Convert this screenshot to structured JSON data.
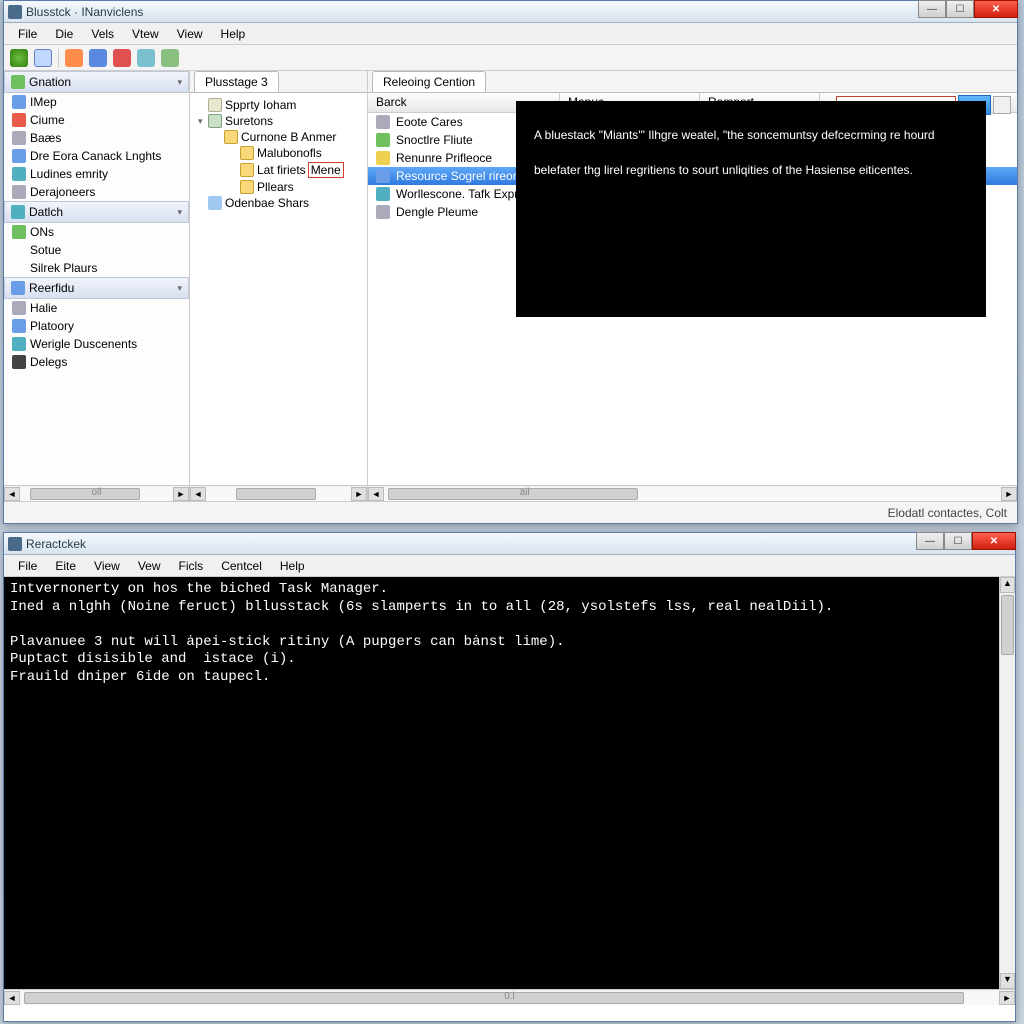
{
  "win1": {
    "title": "Blusstck · INanviclens",
    "menu": [
      "File",
      "Die",
      "Vels",
      "Vtew",
      "View",
      "Help"
    ],
    "status": "Elodatl contactes, Colt",
    "left": {
      "groups": [
        {
          "header": "Gnation",
          "icon": "ci-grn",
          "items": [
            {
              "label": "IMep",
              "icon": "ci-blue"
            },
            {
              "label": "Ciume",
              "icon": "ci-red"
            },
            {
              "label": "Baæs",
              "icon": "ci-gry"
            },
            {
              "label": "Dre Eora Canack Lnghts",
              "icon": "ci-blue"
            },
            {
              "label": "Ludines emrity",
              "icon": "ci-teal"
            },
            {
              "label": "Derajoneers",
              "icon": "ci-gry"
            }
          ]
        },
        {
          "header": "Datlch",
          "icon": "ci-teal",
          "items": [
            {
              "label": "ONs",
              "icon": "ci-grn"
            },
            {
              "label": "Sotue",
              "icon": ""
            },
            {
              "label": "Silrek Plaurs",
              "icon": ""
            }
          ]
        },
        {
          "header": "Reerfidu",
          "icon": "ci-blue",
          "items": [
            {
              "label": "Halie",
              "icon": "ci-gry"
            },
            {
              "label": "Platoory",
              "icon": "ci-blue"
            },
            {
              "label": "Werigle Duscenents",
              "icon": "ci-teal"
            },
            {
              "label": "Delegs",
              "icon": "ci-dk"
            }
          ]
        }
      ],
      "scroll_label": "oll"
    },
    "mid": {
      "tab": "Plusstage 3",
      "tree": [
        {
          "label": "Spprty Ioham",
          "icon": "ti-doc",
          "depth": 0
        },
        {
          "label": "Suretons",
          "icon": "ti-grp",
          "depth": 0,
          "exp": true
        },
        {
          "label": "Curnone B Anmer",
          "icon": "ti-fld",
          "depth": 1
        },
        {
          "label": "Malubonofls",
          "icon": "ti-fld",
          "depth": 2
        },
        {
          "label": "Lat firiets",
          "icon": "ti-fld",
          "depth": 2,
          "suffix": "Mene",
          "redbox": true
        },
        {
          "label": "Pllears",
          "icon": "ti-fld",
          "depth": 2
        },
        {
          "label": "Odenbae Shars",
          "icon": "ti-blu",
          "depth": 0
        }
      ]
    },
    "right": {
      "tab": "Releoing Cention",
      "cols": [
        "Barck",
        "Manuc",
        "Ramport"
      ],
      "rows": [
        {
          "label": "Eoote Cares",
          "icon": "ci-gry"
        },
        {
          "label": "Snoctlre Fliute",
          "icon": "ci-grn"
        },
        {
          "label": "Renunre Prifleoce",
          "icon": "ci-yell"
        },
        {
          "label": "Resource Sogrel rireor",
          "icon": "ci-blue",
          "sel": true
        },
        {
          "label": "Worllescone. Tafk Expres",
          "icon": "ci-teal"
        },
        {
          "label": "Dengle Pleume",
          "icon": "ci-gry"
        }
      ],
      "field_value": "",
      "button_label": "····"
    },
    "overlay_text": "A bluestack \"Miants'\" Ilhgre weatel, \"the soncemuntsy defcecrming re hourd belefater thg lirel regritiens to sourt unliqities of the Hasiense eiticentes."
  },
  "win2": {
    "title": "Reractckek",
    "menu": [
      "File",
      "Eite",
      "View",
      "Vew",
      "Ficls",
      "Centcel",
      "Help"
    ],
    "console_lines": [
      "Intvernonerty on hos the biched Task Manager.",
      "Ined a nlghh (Noine feruct) bllusstack (6s slamperts in to all (28, ysolstefs lss, real nealDiil).",
      "",
      "Plavanuee 3 nut will ȧpei-stick ritiny (A pupgers can bȧnst lime).",
      "Puptact disisible and  istace (i).",
      "Frauild dniper 6ide on taupecl."
    ],
    "scroll_label": "0.l"
  }
}
